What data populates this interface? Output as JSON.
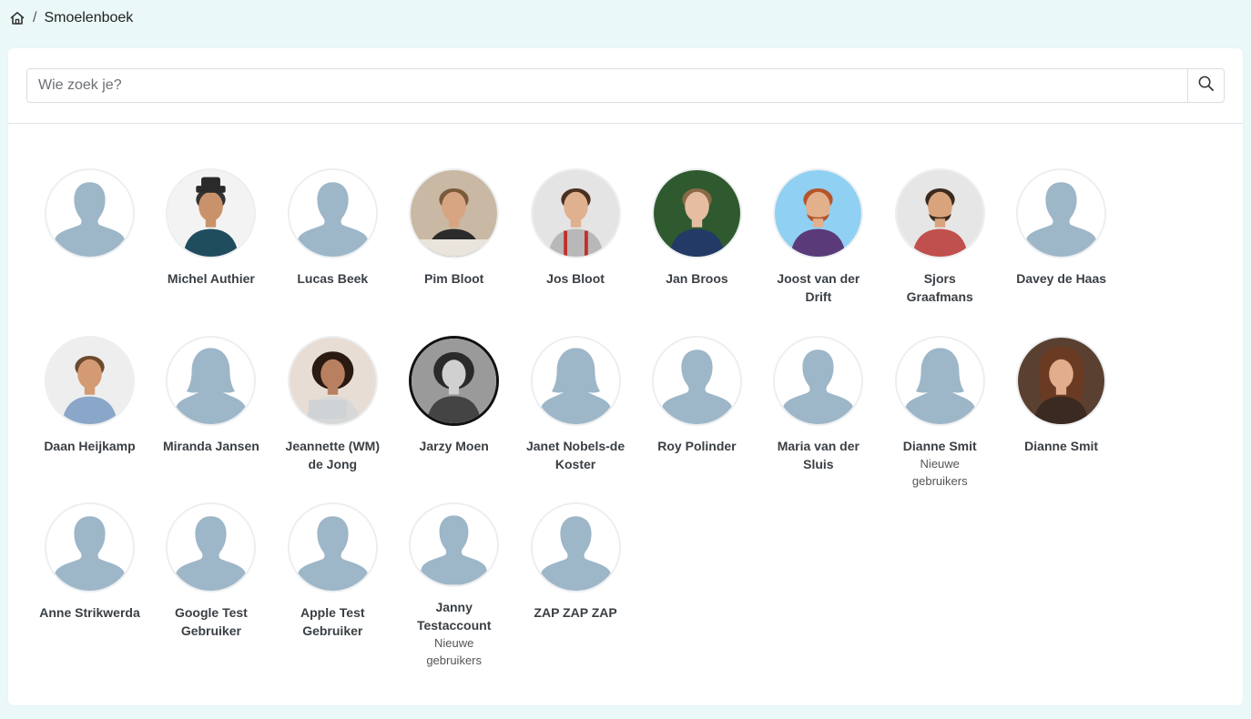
{
  "breadcrumb": {
    "home_icon": "home-icon",
    "separator": "/",
    "current": "Smoelenboek"
  },
  "search": {
    "placeholder": "Wie zoek je?",
    "value": "",
    "button_icon": "search-icon"
  },
  "people": [
    {
      "name": "",
      "group": "",
      "photo": "placeholder-male"
    },
    {
      "name": "Michel Authier",
      "group": "",
      "photo": "photo"
    },
    {
      "name": "Lucas Beek",
      "group": "",
      "photo": "placeholder-male"
    },
    {
      "name": "Pim Bloot",
      "group": "",
      "photo": "photo"
    },
    {
      "name": "Jos Bloot",
      "group": "",
      "photo": "photo"
    },
    {
      "name": "Jan Broos",
      "group": "",
      "photo": "photo"
    },
    {
      "name": "Joost van der Drift",
      "group": "",
      "photo": "photo"
    },
    {
      "name": "Sjors Graafmans",
      "group": "",
      "photo": "photo"
    },
    {
      "name": "Davey de Haas",
      "group": "",
      "photo": "placeholder-male"
    },
    {
      "name": "Daan Heijkamp",
      "group": "",
      "photo": "photo"
    },
    {
      "name": "Miranda Jansen",
      "group": "",
      "photo": "placeholder-female"
    },
    {
      "name": "Jeannette (WM) de Jong",
      "group": "",
      "photo": "photo"
    },
    {
      "name": "Jarzy Moen",
      "group": "",
      "photo": "photo"
    },
    {
      "name": "Janet Nobels-de Koster",
      "group": "",
      "photo": "placeholder-female"
    },
    {
      "name": "Roy Polinder",
      "group": "",
      "photo": "placeholder-male"
    },
    {
      "name": "Maria van der Sluis",
      "group": "",
      "photo": "placeholder-male"
    },
    {
      "name": "Dianne Smit",
      "group": "Nieuwe gebruikers",
      "photo": "placeholder-female"
    },
    {
      "name": "Dianne Smit",
      "group": "",
      "photo": "photo"
    },
    {
      "name": "Anne Strikwerda",
      "group": "",
      "photo": "placeholder-male"
    },
    {
      "name": "Google Test Gebruiker",
      "group": "",
      "photo": "placeholder-male"
    },
    {
      "name": "Apple Test Gebruiker",
      "group": "",
      "photo": "placeholder-male"
    },
    {
      "name": "Janny Testaccount",
      "group": "Nieuwe gebruikers",
      "photo": "placeholder-male"
    },
    {
      "name": "ZAP ZAP ZAP",
      "group": "",
      "photo": "placeholder-male"
    }
  ],
  "colors": {
    "page_bg": "#eaf8f8",
    "placeholder_silhouette": "#9db6c8",
    "name_text": "#3a3f44"
  }
}
